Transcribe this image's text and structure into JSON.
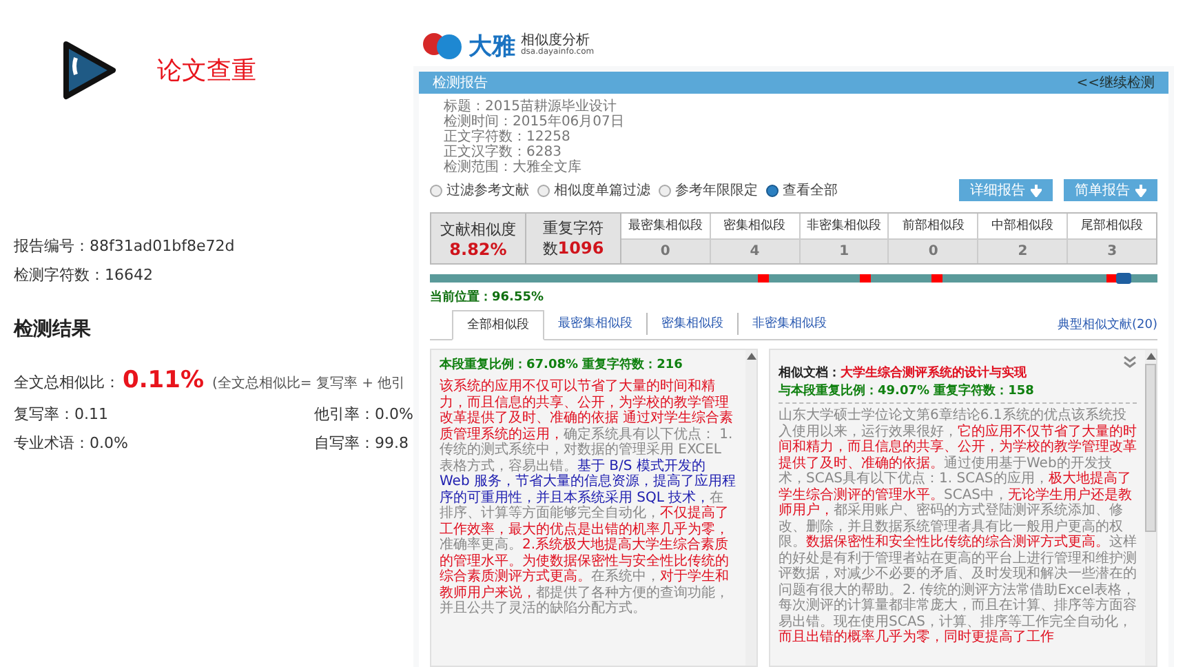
{
  "slide": {
    "title": "论文查重"
  },
  "summary": {
    "lines": [
      "报告编号：88f31ad01bf8e72d",
      "检测字符数：16642"
    ],
    "heading": "检测结果",
    "total_label": "全文总相似比：",
    "total_value": "0.11%",
    "total_formula": "(全文总相似比= 复写率 + 他引",
    "rates": [
      {
        "label": "复写率：0.11"
      },
      {
        "label": "他引率：0.0%"
      },
      {
        "label": "专业术语：0.0%"
      },
      {
        "label": "自写率：99.8"
      }
    ]
  },
  "report": {
    "brand": "大雅",
    "product": "相似度分析",
    "domain": "dsa.dayainfo.com",
    "bar_title": "检测报告",
    "continue_link": "<<继续检测",
    "info": [
      "标题：2015苗耕源毕业设计",
      "检测时间：2015年06月07日",
      "正文字符数：12258",
      "正文汉字数：6283",
      "检测范围：大雅全文库"
    ],
    "filters": [
      {
        "label": "过滤参考文献",
        "selected": false
      },
      {
        "label": "相似度单篇过滤",
        "selected": false
      },
      {
        "label": "参考年限限定",
        "selected": false
      },
      {
        "label": "查看全部",
        "selected": true
      }
    ],
    "buttons": [
      "详细报告",
      "简单报告"
    ],
    "similarity_label": "文献相似度",
    "similarity_value": "8.82%",
    "repeat_label_1": "重复字符",
    "repeat_label_2": "数",
    "repeat_value": "1096",
    "stats": [
      {
        "label": "最密集相似段",
        "value": "0"
      },
      {
        "label": "密集相似段",
        "value": "4"
      },
      {
        "label": "非密集相似段",
        "value": "1"
      },
      {
        "label": "前部相似段",
        "value": "0"
      },
      {
        "label": "中部相似段",
        "value": "2"
      },
      {
        "label": "尾部相似段",
        "value": "3"
      }
    ],
    "position": {
      "level": 0.9655,
      "label": "当前位置：96.55%"
    },
    "tabs": [
      {
        "label": "全部相似段",
        "selected": true
      },
      {
        "label": "最密集相似段",
        "selected": false
      },
      {
        "label": "密集相似段",
        "selected": false
      },
      {
        "label": "非密集相似段",
        "selected": false
      }
    ],
    "typical_link": "典型相似文献(20)",
    "source_panel": {
      "header": "本段重复比例：67.08% 重复字符数：216",
      "segments": [
        {
          "kind": "red",
          "text": "该系统的应用不仅可以节省了大量的时间和精力，而且信息的共享、公开，为学校的教学管理改革提供了及时、准确的依据 通过对学生综合素质管理系统的运用，"
        },
        {
          "kind": "plain",
          "text": "确定系统具有以下优点： 1.传统的测式系统中，对数据的管理采用 EXCEL 表格方式，容易出错。"
        },
        {
          "kind": "blue",
          "text": "基于 B/S 模式开发的 Web 服务，节省大量的信息资源，提高了应用程序的可重用性，并且本系统采用 SQL 技术，"
        },
        {
          "kind": "plain",
          "text": "在排序、计算等方面能够完全自动化，"
        },
        {
          "kind": "red",
          "text": "不仅提高了工作效率，最大的优点是出错的机率几乎为零，"
        },
        {
          "kind": "plain",
          "text": "准确率更高。"
        },
        {
          "kind": "red",
          "text": "2.系统极大地提高大学生综合素质的管理水平。为使数据保密性与安全性比传统的综合素质测评方式更高。"
        },
        {
          "kind": "plain",
          "text": "在系统中，"
        },
        {
          "kind": "red",
          "text": "对于学生和教师用户来说，"
        },
        {
          "kind": "plain",
          "text": "都提供了各种方便的查询功能，并且公共了灵活的缺陷分配方式。"
        }
      ]
    },
    "match_panel": {
      "doc_label": "相似文档：",
      "doc_title": "大学生综合测评系统的设计与实现",
      "header": "与本段重复比例：49.07% 重复字符数：158",
      "segments": [
        {
          "kind": "plain",
          "text": "山东大学硕士学位论文第6章结论6.1系统的优点该系统投入使用以来，运行效果很好，"
        },
        {
          "kind": "red",
          "text": "它的应用不仅节省了大量的时间和精力，而且信息的共享、公开，为学校的教学管理改革提供了及时、准确的依据。"
        },
        {
          "kind": "plain",
          "text": "通过使用基于Web的开发技术，SCAS具有以下优点：1. SCAS的应用，"
        },
        {
          "kind": "red",
          "text": "极大地提高了学生综合测评的管理水平。"
        },
        {
          "kind": "plain",
          "text": "SCAS中，"
        },
        {
          "kind": "red",
          "text": "无论学生用户还是教师用户，"
        },
        {
          "kind": "plain",
          "text": "都采用账户、密码的方式登陆测评系统添加、修改、删除，并且数据系统管理者具有比一般用户更高的权限。"
        },
        {
          "kind": "red",
          "text": "数据保密性和安全性比传统的综合测评方式更高。"
        },
        {
          "kind": "plain",
          "text": "这样的好处是有利于管理者站在更高的平台上进行管理和维护测评数据，对减少不必要的矛盾、及时发现和解决一些潜在的问题有很大的帮助。2. 传统的测评方法常借助Excel表格，每次测评的计算量都非常庞大，而且在计算、排序等方面容易出错。现在使用SCAS，计算、排序等工作完全自动化，"
        },
        {
          "kind": "red",
          "text": "而且出错的概率几乎为零，同时更提高了工作"
        }
      ]
    }
  }
}
